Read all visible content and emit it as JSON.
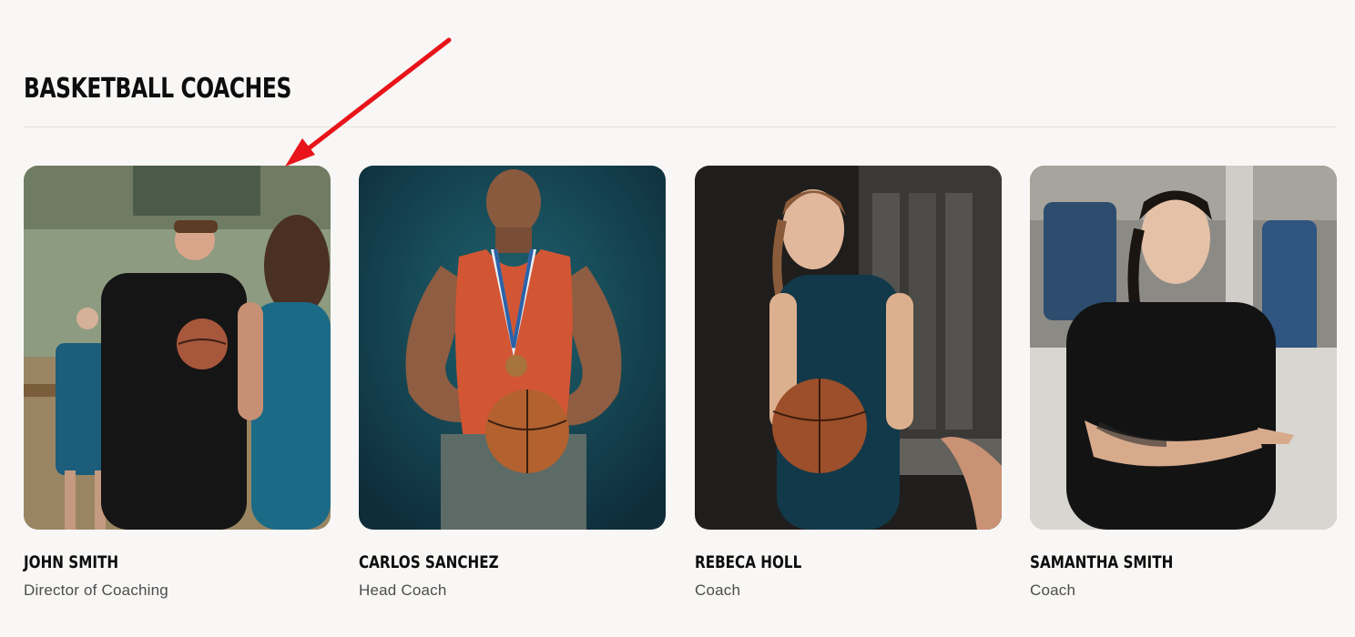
{
  "section": {
    "title": "BASKETBALL COACHES"
  },
  "coaches": [
    {
      "name": "JOHN SMITH",
      "role": "Director of Coaching",
      "photo_alt": "Coach holding a basketball talking to players in a gym"
    },
    {
      "name": "CARLOS SANCHEZ",
      "role": "Head Coach",
      "photo_alt": "Man in orange jersey with medal holding a basketball"
    },
    {
      "name": "REBECA HOLL",
      "role": "Coach",
      "photo_alt": "Smiling player in teal jersey holding a basketball in locker room"
    },
    {
      "name": "SAMANTHA SMITH",
      "role": "Coach",
      "photo_alt": "Woman in black shirt pointing while giving instructions in locker room"
    }
  ],
  "annotation": {
    "arrow_color": "#e8141a"
  }
}
